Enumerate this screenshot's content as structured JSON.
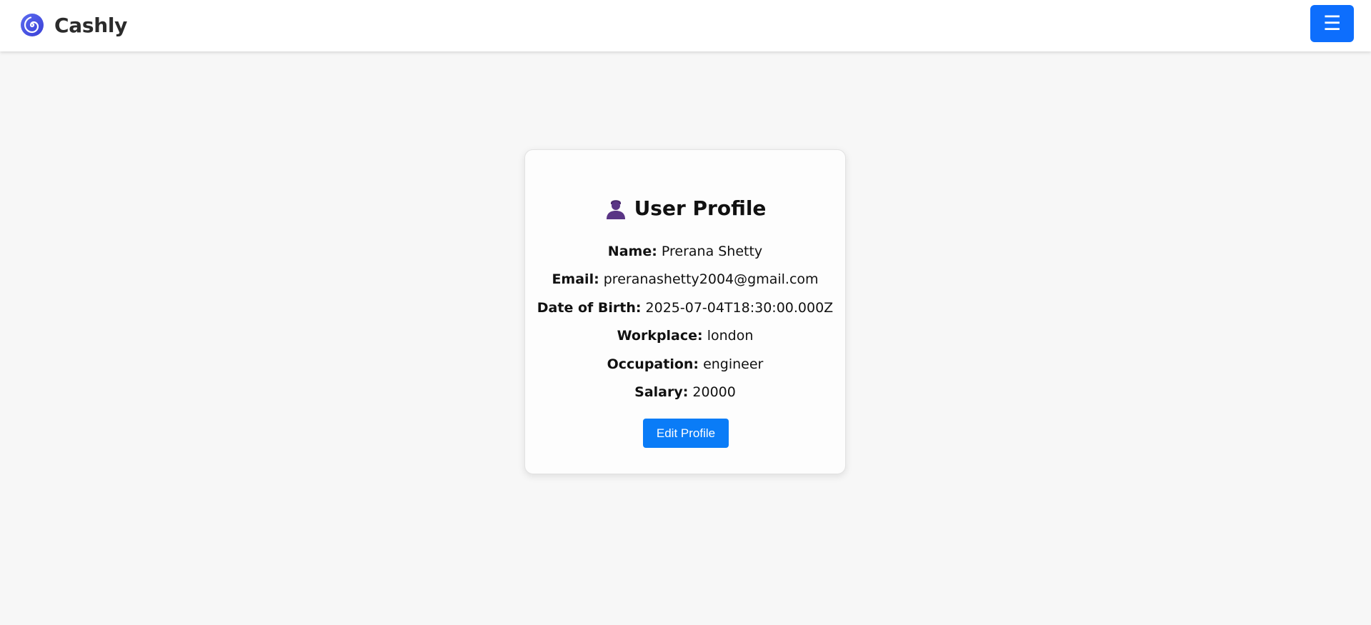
{
  "navbar": {
    "brand_name": "Cashly",
    "logo_icon": "spiral-logo-icon",
    "menu_icon": "hamburger-menu-icon",
    "menu_label": "☰",
    "accent_color": "#0d6efd"
  },
  "profile": {
    "title": "User Profile",
    "title_icon": "user-silhouette-icon",
    "fields": [
      {
        "label": "Name:",
        "value": "Prerana Shetty"
      },
      {
        "label": "Email:",
        "value": "preranashetty2004@gmail.com"
      },
      {
        "label": "Date of Birth:",
        "value": "2025-07-04T18:30:00.000Z"
      },
      {
        "label": "Workplace:",
        "value": "london"
      },
      {
        "label": "Occupation:",
        "value": "engineer"
      },
      {
        "label": "Salary:",
        "value": "20000"
      }
    ],
    "edit_button_label": "Edit Profile",
    "button_color": "#0a7cf7"
  }
}
